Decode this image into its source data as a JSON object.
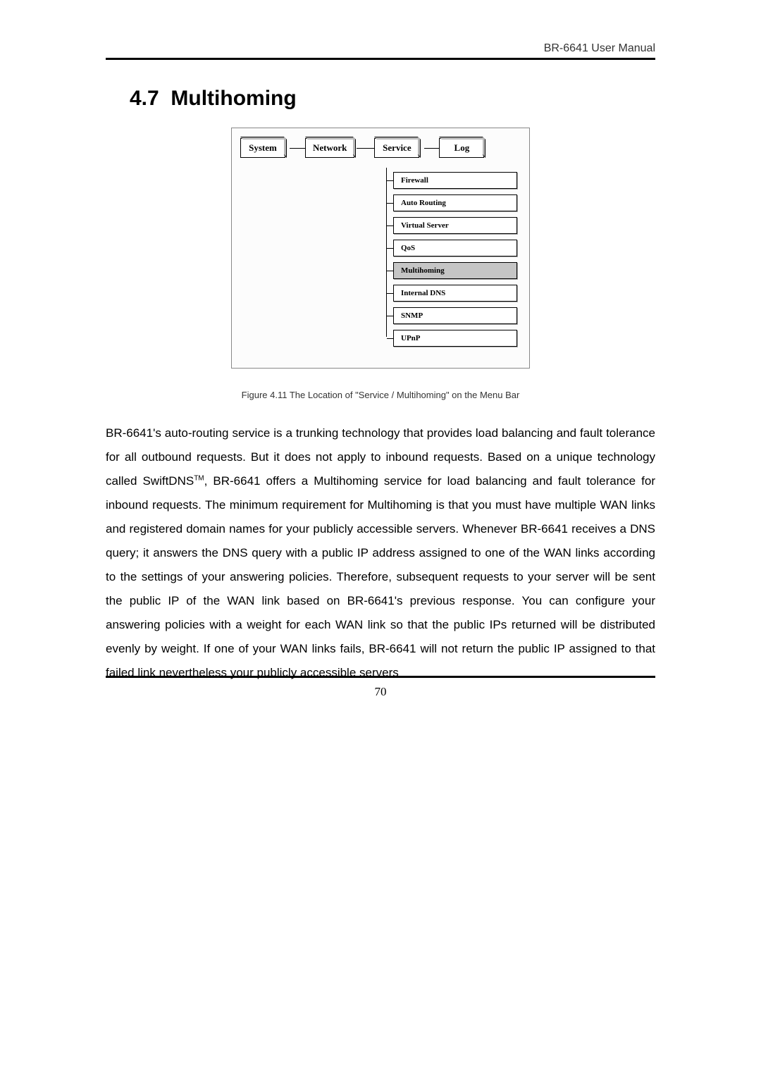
{
  "header": {
    "doc_title": "BR-6641 User Manual"
  },
  "section": {
    "number": "4.7",
    "title": "Multihoming"
  },
  "menu": {
    "tabs": [
      "System",
      "Network",
      "Service",
      "Log"
    ],
    "submenu": [
      {
        "label": "Firewall",
        "active": false
      },
      {
        "label": "Auto Routing",
        "active": false
      },
      {
        "label": "Virtual Server",
        "active": false
      },
      {
        "label": "QoS",
        "active": false
      },
      {
        "label": "Multihoming",
        "active": true
      },
      {
        "label": "Internal DNS",
        "active": false
      },
      {
        "label": "SNMP",
        "active": false
      },
      {
        "label": "UPnP",
        "active": false
      }
    ]
  },
  "figure_caption": "Figure 4.11 The Location of \"Service / Multihoming\" on the Menu Bar",
  "body": {
    "p1_a": "BR-6641's auto-routing service is a trunking technology that provides load balancing and fault tolerance for all outbound requests. But it does not apply to inbound requests. Based on a unique technology called SwiftDNS",
    "p1_sup": "TM",
    "p1_b": ", BR-6641 offers a Multihoming service for load balancing and fault tolerance for inbound requests. The minimum requirement for Multihoming is that you must have multiple WAN links and registered domain names for your publicly accessible servers. Whenever BR-6641 receives a DNS query; it answers the DNS query with a public IP address assigned to one of the WAN links according to the settings of your answering policies. Therefore, subsequent requests to your server will be sent the public IP of the WAN link based on BR-6641's previous response. You can configure your answering policies with a weight for each WAN link so that the public IPs returned will be distributed evenly by weight. If one of your WAN links fails, BR-6641 will not return the public IP assigned to that failed link nevertheless your publicly accessible servers"
  },
  "page_number": "70"
}
